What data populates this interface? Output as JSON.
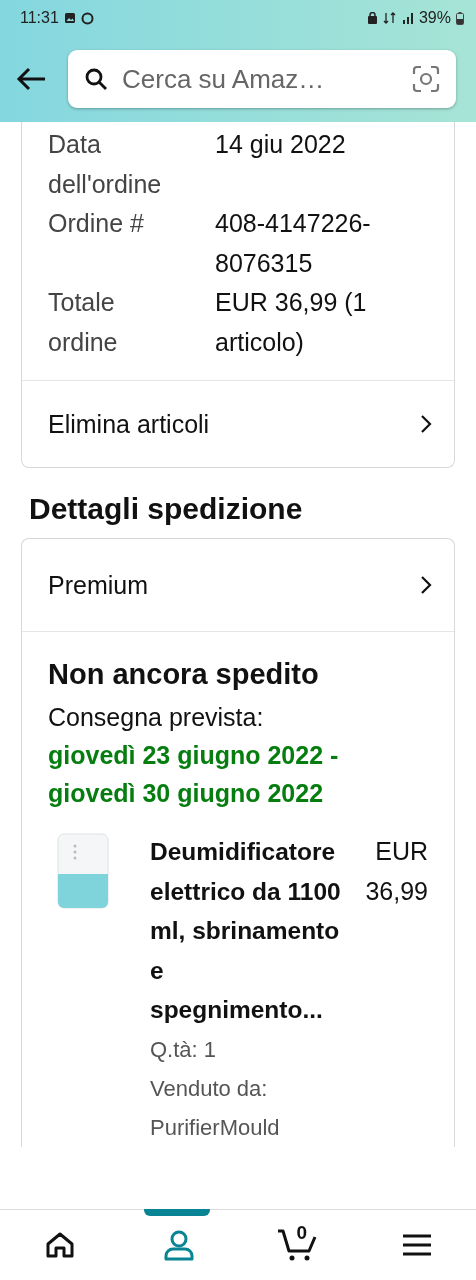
{
  "status_bar": {
    "time": "11:31",
    "battery": "39%"
  },
  "search": {
    "placeholder": "Cerca su Amaz…"
  },
  "order_details": [
    {
      "label": "Data dell'ordine",
      "value": "14 giu 2022"
    },
    {
      "label": "Ordine #",
      "value": "408-4147226-8076315"
    },
    {
      "label": "Totale ordine",
      "value": "EUR 36,99 (1 articolo)"
    }
  ],
  "order_action": "Elimina articoli",
  "shipment": {
    "heading": "Dettagli spedizione",
    "shipping_type": "Premium",
    "status": "Non ancora spedito",
    "delivery_label": "Consegna prevista:",
    "delivery_dates": "giovedì 23 giugno 2022 - giovedì 30 giugno 2022",
    "item": {
      "title": "Deumidificatore elettrico da 1100 ml, sbrinamento e spegnimento...",
      "price": "EUR 36,99",
      "quantity": "Q.tà: 1",
      "seller": "Venduto da: PurifierMould"
    }
  },
  "bottom_nav": [
    {
      "kind": "home",
      "selected": false
    },
    {
      "kind": "account",
      "selected": true
    },
    {
      "kind": "cart",
      "selected": false,
      "count": "0"
    },
    {
      "kind": "menu",
      "selected": false
    }
  ]
}
